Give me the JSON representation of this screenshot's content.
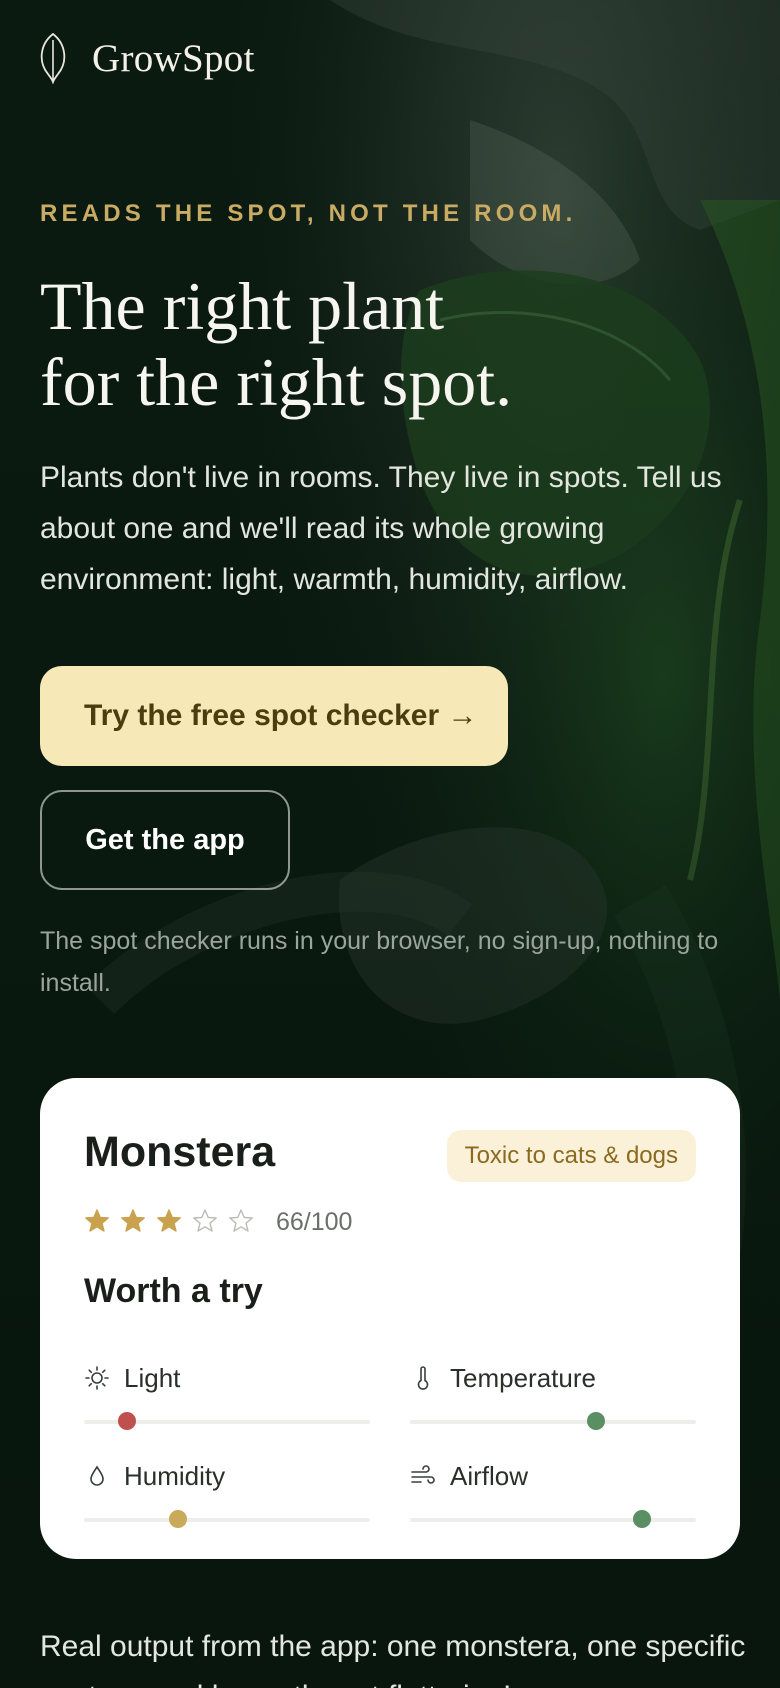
{
  "brand": {
    "name": "GrowSpot",
    "logo_icon": "leaf-icon"
  },
  "hero": {
    "eyebrow": "READS THE SPOT, NOT THE ROOM.",
    "headline_line1": "The right plant",
    "headline_line2": "for the right spot.",
    "lead": "Plants don't live in rooms. They live in spots. Tell us about one and we'll read its whole growing environment: light, warmth, humidity, airflow.",
    "primary_cta": "Try the free spot checker →",
    "secondary_cta": "Get the app",
    "note": "The spot checker runs in your browser, no sign-up, nothing to install."
  },
  "card": {
    "plant_name": "Monstera",
    "badge": "Toxic to cats & dogs",
    "rating": {
      "stars_filled": 3,
      "stars_total": 5
    },
    "score": "66/100",
    "verdict": "Worth a try",
    "metrics": [
      {
        "label": "Light",
        "icon": "sun-icon",
        "level": 0.15,
        "color": "#c0504d"
      },
      {
        "label": "Temperature",
        "icon": "thermometer-icon",
        "level": 0.65,
        "color": "#5a8f64"
      },
      {
        "label": "Humidity",
        "icon": "droplet-icon",
        "level": 0.33,
        "color": "#c9a95a"
      },
      {
        "label": "Airflow",
        "icon": "wind-icon",
        "level": 0.81,
        "color": "#5a8f64"
      }
    ]
  },
  "caption": "Real output from the app: one monstera, one specific spot, scored honestly, not flattering!"
}
